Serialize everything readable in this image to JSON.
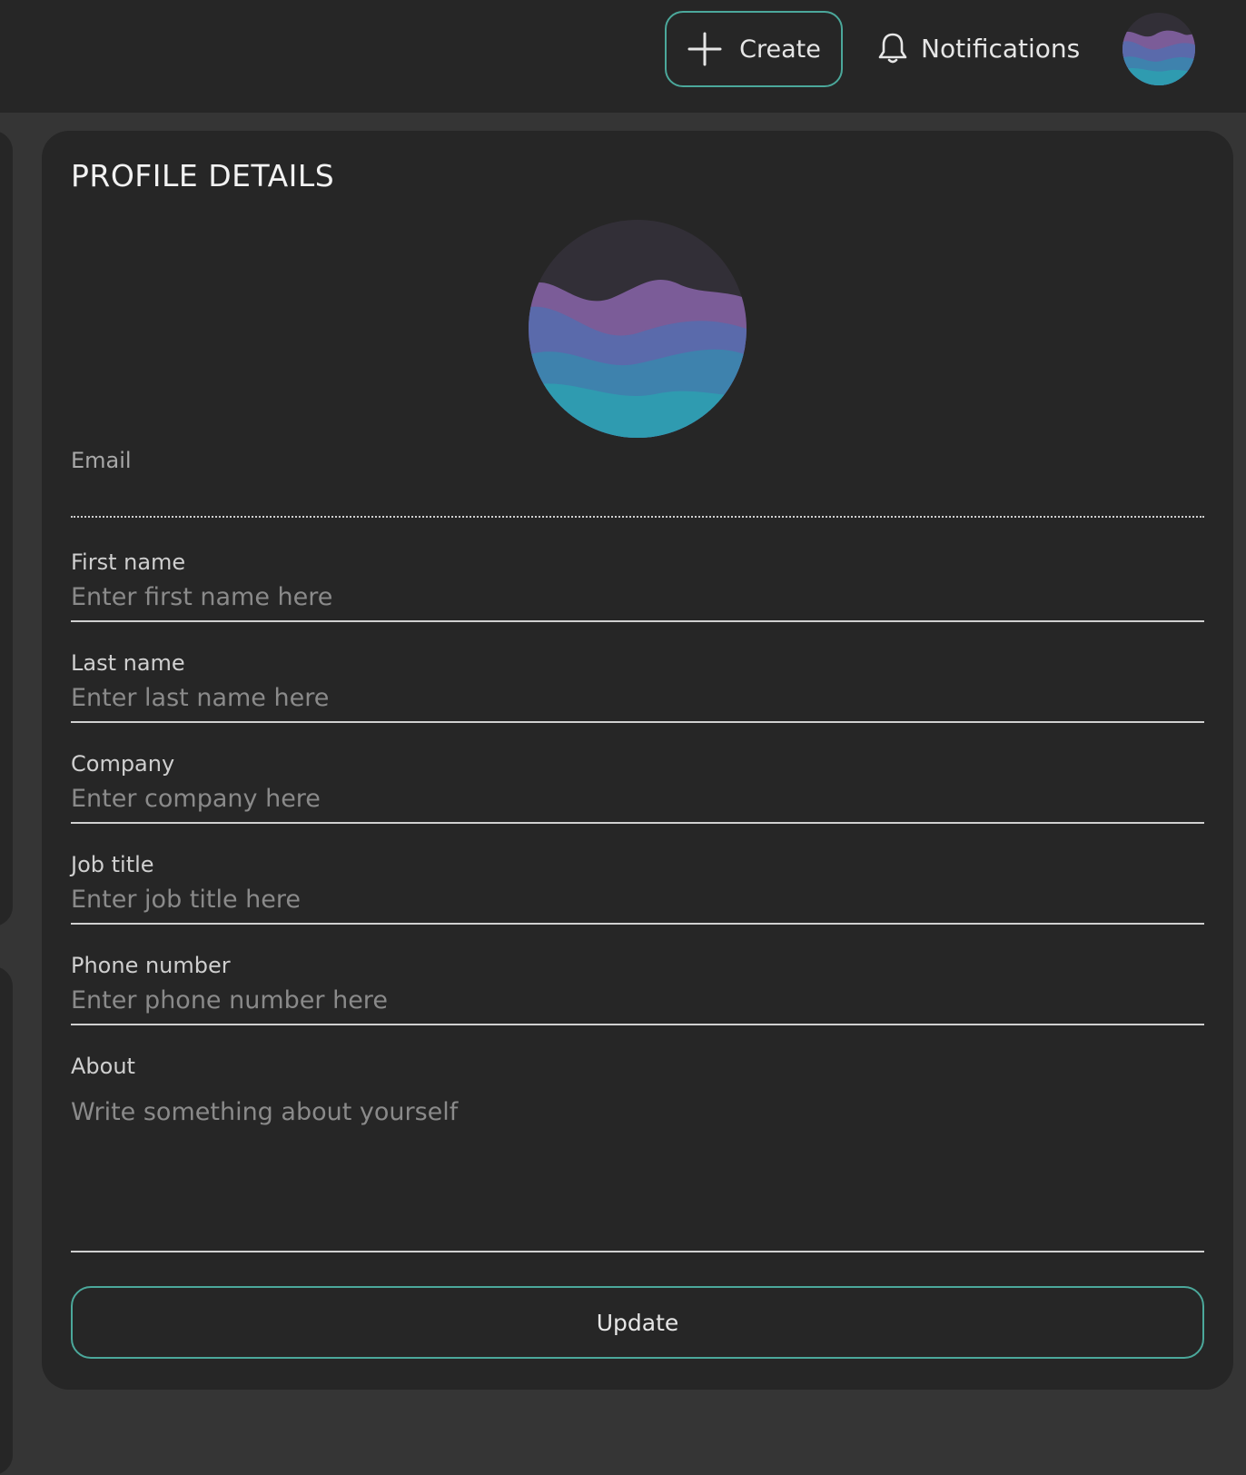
{
  "header": {
    "create_label": "Create",
    "create_icon": "plus-icon",
    "notifications_label": "Notifications",
    "notifications_icon": "bell-icon",
    "avatar_icon": "wave-avatar"
  },
  "profile": {
    "title": "PROFILE DETAILS",
    "fields": {
      "email": {
        "label": "Email",
        "value": "",
        "placeholder": ""
      },
      "first_name": {
        "label": "First name",
        "value": "",
        "placeholder": "Enter first name here"
      },
      "last_name": {
        "label": "Last name",
        "value": "",
        "placeholder": "Enter last name here"
      },
      "company": {
        "label": "Company",
        "value": "",
        "placeholder": "Enter company here"
      },
      "job_title": {
        "label": "Job title",
        "value": "",
        "placeholder": "Enter job title here"
      },
      "phone": {
        "label": "Phone number",
        "value": "",
        "placeholder": "Enter phone number here"
      },
      "about": {
        "label": "About",
        "value": "",
        "placeholder": "Write something about yourself"
      }
    },
    "update_label": "Update"
  },
  "colors": {
    "page_bg": "#353535",
    "surface": "#262626",
    "accent": "#4ba89b",
    "text": "#e6e6e6",
    "placeholder": "#8a8a8a"
  }
}
